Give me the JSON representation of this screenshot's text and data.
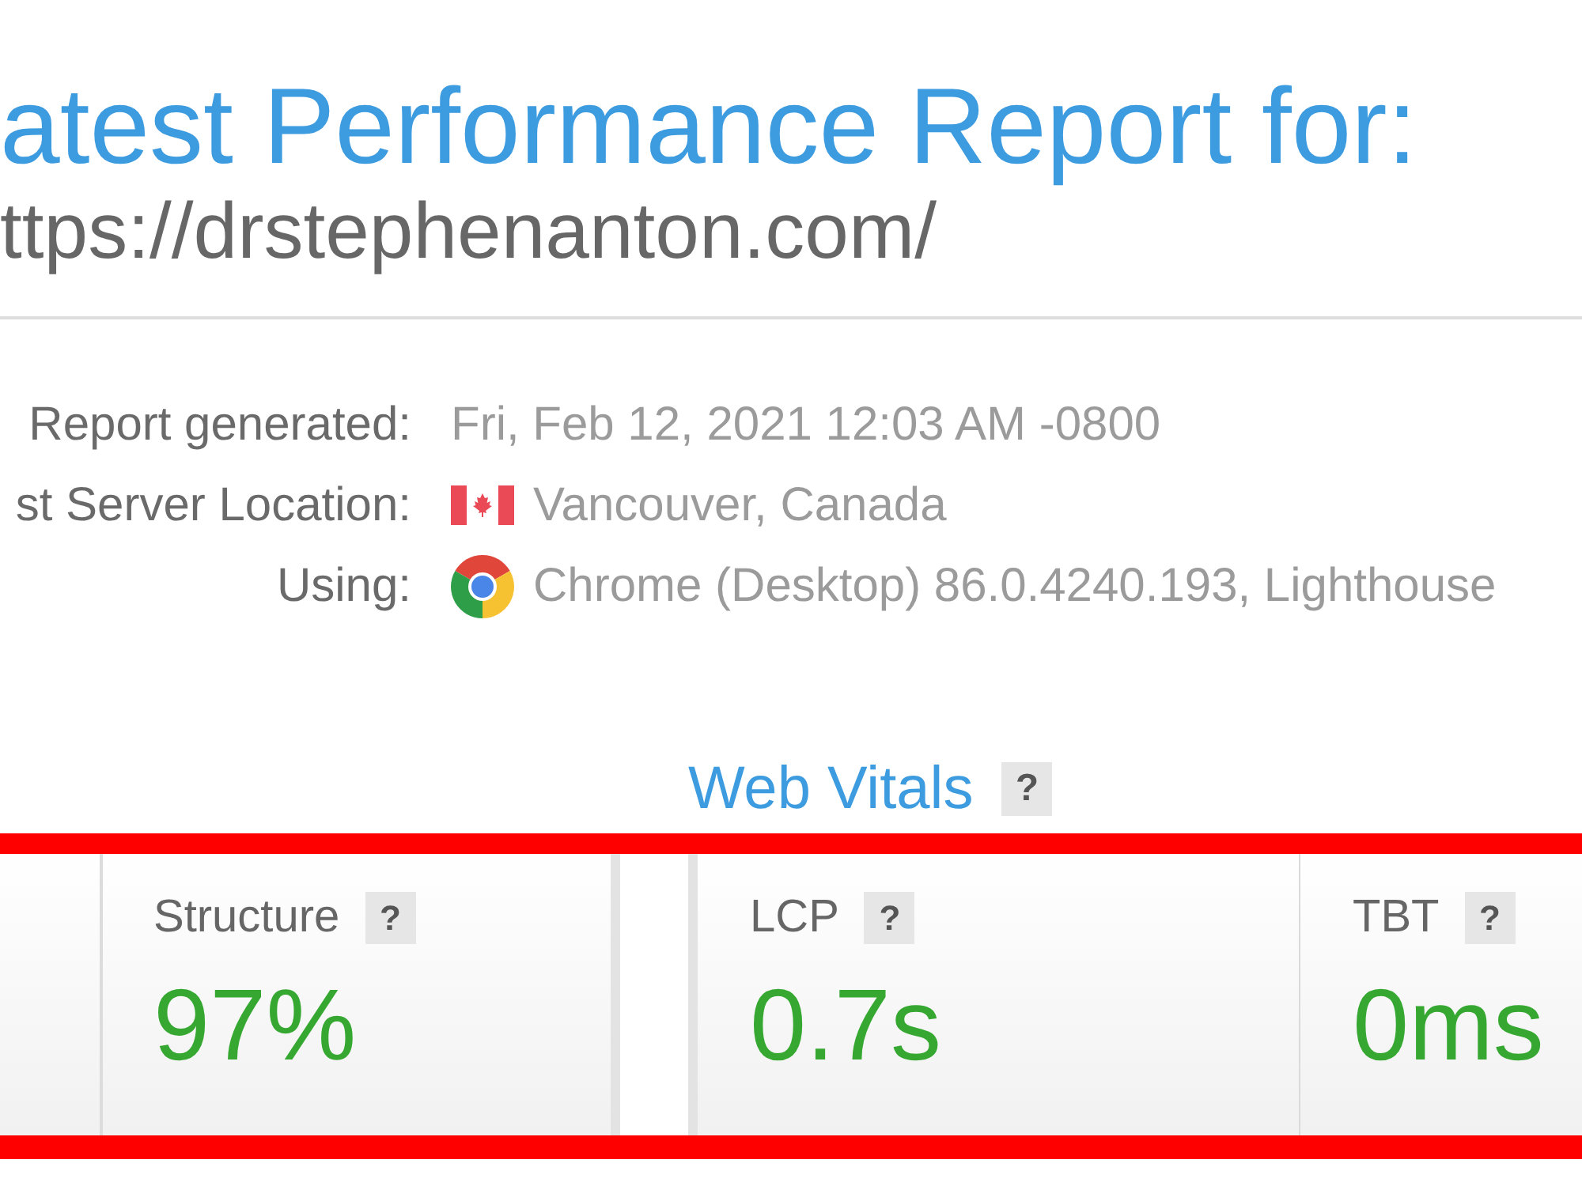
{
  "report": {
    "title": "atest Performance Report for:",
    "url": "ttps://drstephenanton.com/"
  },
  "details": [
    {
      "kind": "text",
      "label": "Report generated:",
      "value": "Fri, Feb 12, 2021 12:03 AM -0800"
    },
    {
      "kind": "location",
      "label": "st Server Location:",
      "value": "Vancouver, Canada"
    },
    {
      "kind": "browser",
      "label": "Using:",
      "value": "Chrome (Desktop) 86.0.4240.193, Lighthouse"
    }
  ],
  "web_vitals": {
    "title": "Web Vitals",
    "help": "?"
  },
  "metric_groups": [
    {
      "metrics": [
        {
          "label": "Structure",
          "help": "?",
          "value": "97%",
          "color": "#36a832"
        }
      ]
    },
    {
      "metrics": [
        {
          "label": "LCP",
          "help": "?",
          "value": "0.7s",
          "color": "#36a832"
        },
        {
          "label": "TBT",
          "help": "?",
          "value": "0ms",
          "color": "#36a832"
        }
      ]
    }
  ]
}
